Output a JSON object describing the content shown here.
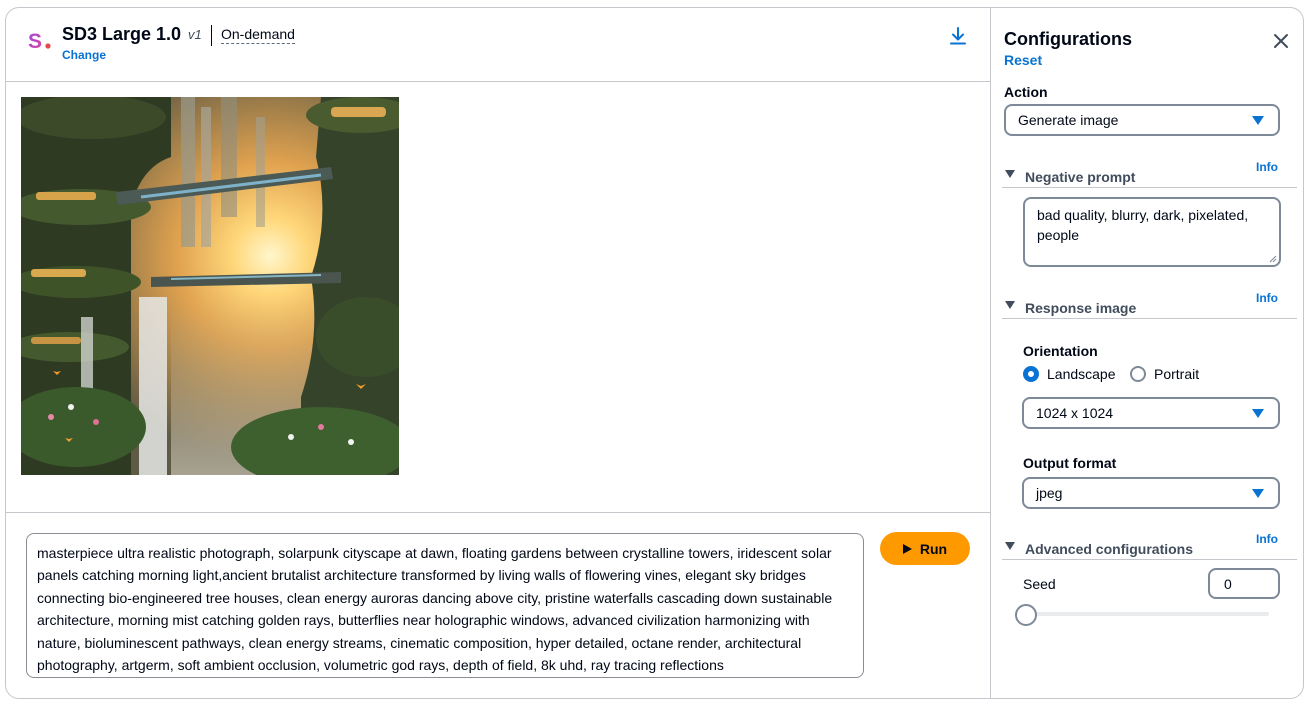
{
  "header": {
    "model_name": "SD3 Large 1.0",
    "model_version": "v1",
    "mode": "On-demand",
    "change_link": "Change"
  },
  "image": {
    "alt": "Generated image"
  },
  "prompt": {
    "text": "masterpiece ultra realistic photograph, solarpunk cityscape at dawn, floating gardens between crystalline towers, iridescent solar panels catching morning light,ancient brutalist architecture transformed by living walls of flowering vines, elegant sky bridges connecting bio-engineered tree houses, clean energy auroras dancing above city, pristine waterfalls cascading down sustainable architecture, morning mist catching golden rays, butterflies near holographic windows, advanced civilization harmonizing with nature, bioluminescent pathways, clean energy streams, cinematic composition, hyper detailed, octane render, architectural photography, artgerm, soft ambient occlusion, volumetric god rays, depth of field, 8k uhd, ray tracing reflections"
  },
  "run_button": {
    "label": "Run"
  },
  "config": {
    "title": "Configurations",
    "reset": "Reset",
    "action_label": "Action",
    "action_value": "Generate image",
    "negative": {
      "title": "Negative prompt",
      "info": "Info",
      "value": "bad quality, blurry, dark, pixelated, people"
    },
    "response": {
      "title": "Response image",
      "info": "Info",
      "orientation_label": "Orientation",
      "landscape": "Landscape",
      "portrait": "Portrait",
      "selected_orientation": "Landscape",
      "size": "1024 x 1024",
      "output_format_label": "Output format",
      "output_format": "jpeg"
    },
    "advanced": {
      "title": "Advanced configurations",
      "info": "Info",
      "seed_label": "Seed",
      "seed_value": "0",
      "seed_slider_fraction": 0
    }
  },
  "colors": {
    "accent": "#0972d3",
    "run": "#ff9900",
    "border": "#c6c6cd"
  },
  "icons": [
    "stability-logo-icon",
    "download-icon",
    "close-icon",
    "play-icon",
    "caret-down-icon",
    "triangle-down-icon"
  ]
}
